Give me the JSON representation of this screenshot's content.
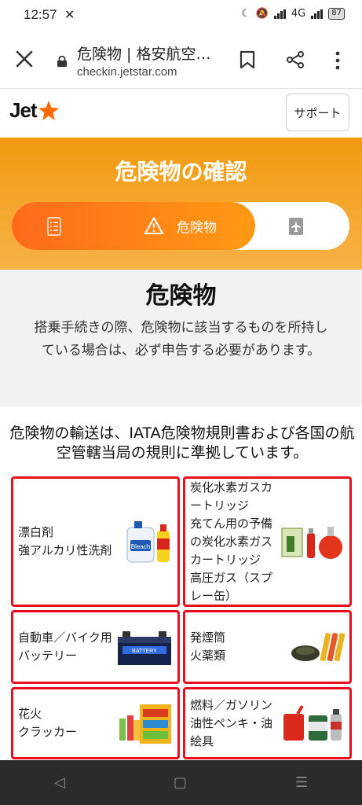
{
  "status_bar": {
    "time": "12:57",
    "battery": "87",
    "network": "4G"
  },
  "browser": {
    "title": "危険物 | 格安航空…",
    "url": "checkin.jetstar.com"
  },
  "header": {
    "logo_text": "Jet",
    "support_label": "サポート"
  },
  "banner": {
    "heading": "危険物の確認",
    "steps": [
      {
        "icon": "document-list-icon",
        "label": ""
      },
      {
        "icon": "warning-icon",
        "label": "危険物"
      },
      {
        "icon": "boarding-pass-icon",
        "label": ""
      }
    ],
    "accent": "#ff7a18"
  },
  "intro": {
    "title": "危険物",
    "description": "搭乗手続きの際、危険物に該当するものを所持している場合は、必ず申告する必要があります。"
  },
  "notice": "危険物の輸送は、IATA危険物規則書および各国の航空管轄当局の規則に準拠しています。",
  "items": [
    {
      "text": "漂白剤\n強アルカリ性洗剤",
      "image": "bleach-bottles"
    },
    {
      "text": "炭化水素ガスカートリッジ\n充てん用の予備の炭化水素ガスカートリッジ\n高圧ガス（スプレー缶）",
      "image": "gas-cartridges"
    },
    {
      "text": "自動車／バイク用バッテリー",
      "image": "car-battery"
    },
    {
      "text": "発煙筒\n火薬類",
      "image": "flares"
    },
    {
      "text": "花火\nクラッカー",
      "image": "fireworks"
    },
    {
      "text": "燃料／ガソリン\n油性ペンキ・油絵具",
      "image": "fuel-cans"
    }
  ],
  "colors": {
    "brand_orange": "#f29a10",
    "grid_border": "#e8101e"
  }
}
